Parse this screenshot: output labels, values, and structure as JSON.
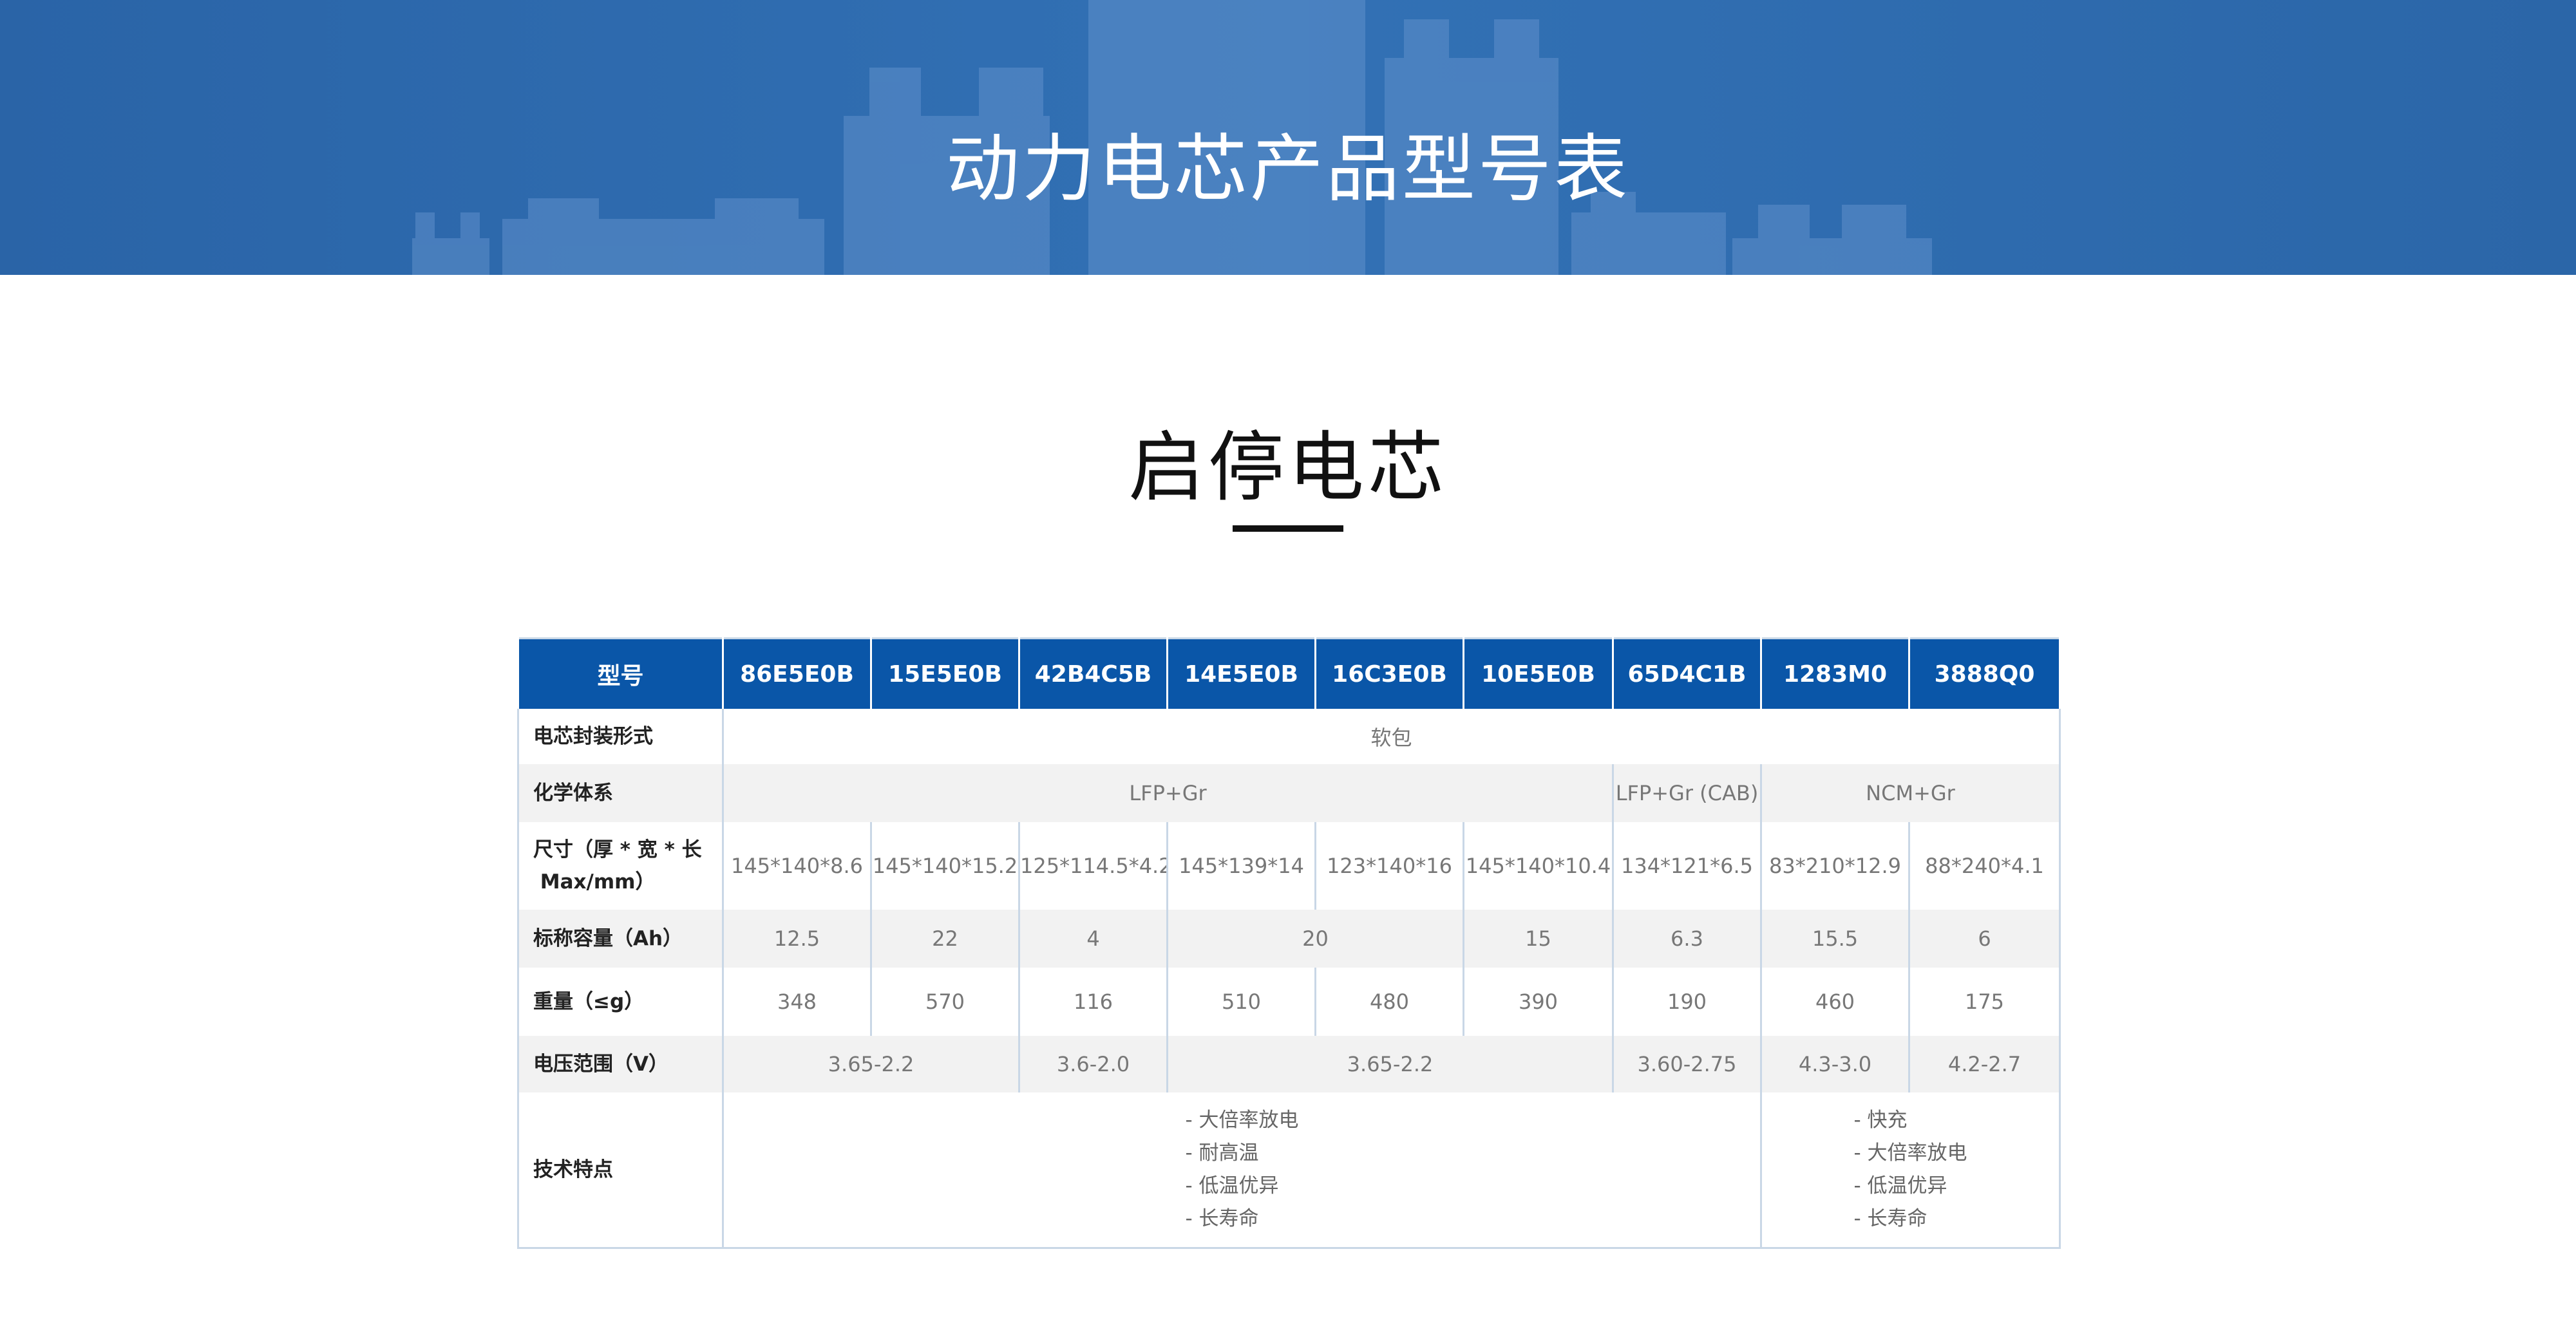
{
  "banner": {
    "title": "动力电芯产品型号表"
  },
  "section": {
    "title": "启停电芯"
  },
  "table": {
    "header": {
      "label": "型号",
      "models": [
        "86E5E0B",
        "15E5E0B",
        "42B4C5B",
        "14E5E0B",
        "16C3E0B",
        "10E5E0B",
        "65D4C1B",
        "1283M0",
        "3888Q0"
      ]
    },
    "rows": {
      "package": {
        "label": "电芯封装形式",
        "value": "软包"
      },
      "chemistry": {
        "label": "化学体系",
        "values": [
          "LFP+Gr",
          "LFP+Gr (CAB)",
          "NCM+Gr"
        ]
      },
      "size": {
        "label_line1": "尺寸（厚 * 宽 * 长",
        "label_line2": " Max/mm）",
        "values": [
          "145*140*8.6",
          "145*140*15.2",
          "125*114.5*4.2",
          "145*139*14",
          "123*140*16",
          "145*140*10.4",
          "134*121*6.5",
          "83*210*12.9",
          "88*240*4.1"
        ]
      },
      "capacity": {
        "label": "标称容量（Ah）",
        "values": [
          "12.5",
          "22",
          "4",
          "20",
          "15",
          "6.3",
          "15.5",
          "6"
        ]
      },
      "weight": {
        "label": "重量（≤g）",
        "values": [
          "348",
          "570",
          "116",
          "510",
          "480",
          "390",
          "190",
          "460",
          "175"
        ]
      },
      "voltage": {
        "label": "电压范围（V）",
        "values": [
          "3.65-2.2",
          "3.6-2.0",
          "3.65-2.2",
          "3.60-2.75",
          "4.3-3.0",
          "4.2-2.7"
        ]
      },
      "features": {
        "label": "技术特点",
        "group_a": [
          "- 大倍率放电",
          "- 耐高温",
          "- 低温优异",
          "- 长寿命"
        ],
        "group_b": [
          "- 快充",
          "- 大倍率放电",
          "- 低温优异",
          "- 长寿命"
        ]
      }
    }
  },
  "colors": {
    "banner": "#2f6db1",
    "header": "#0a56a8",
    "border": "#c9d7e6",
    "stripe": "#f2f2f2"
  }
}
